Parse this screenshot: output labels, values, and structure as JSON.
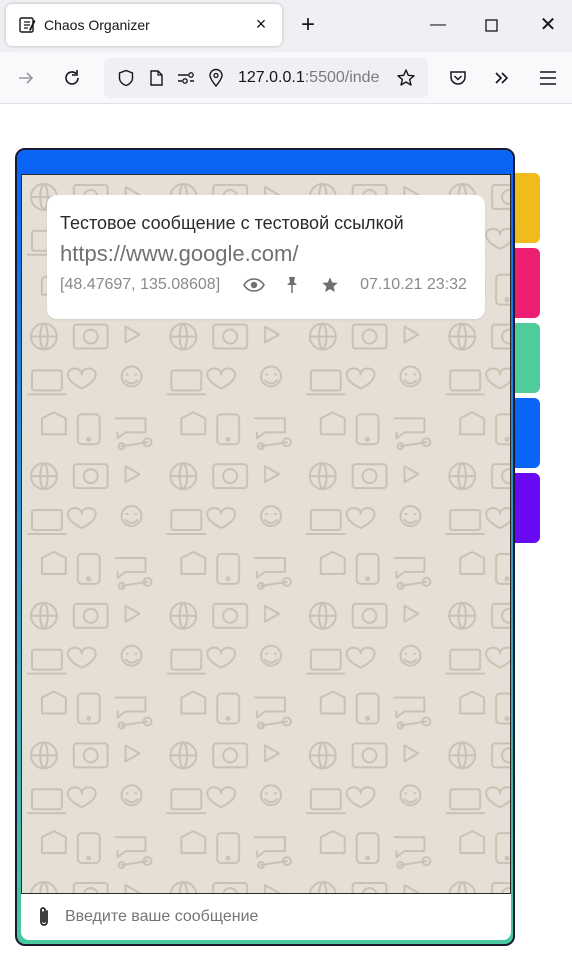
{
  "browser": {
    "tab_title": "Chaos Organizer",
    "url_host": "127.0.0.1",
    "url_rest": ":5500/inde"
  },
  "app": {
    "categories": [
      {
        "name": "yellow",
        "color": "#f0bc1c"
      },
      {
        "name": "pink",
        "color": "#ee1f73"
      },
      {
        "name": "green",
        "color": "#4ecc9a"
      },
      {
        "name": "blue",
        "color": "#0a64f5"
      },
      {
        "name": "purple",
        "color": "#6a0af5"
      }
    ],
    "message": {
      "text": "Тестовое сообщение с тестовой ссылкой",
      "link": "https://www.google.com/",
      "coords": "[48.47697, 135.08608]",
      "date": "07.10.21 23:32",
      "icons": [
        "eye-icon",
        "pin-icon",
        "star-icon"
      ]
    },
    "input": {
      "placeholder": "Введите ваше сообщение"
    }
  }
}
